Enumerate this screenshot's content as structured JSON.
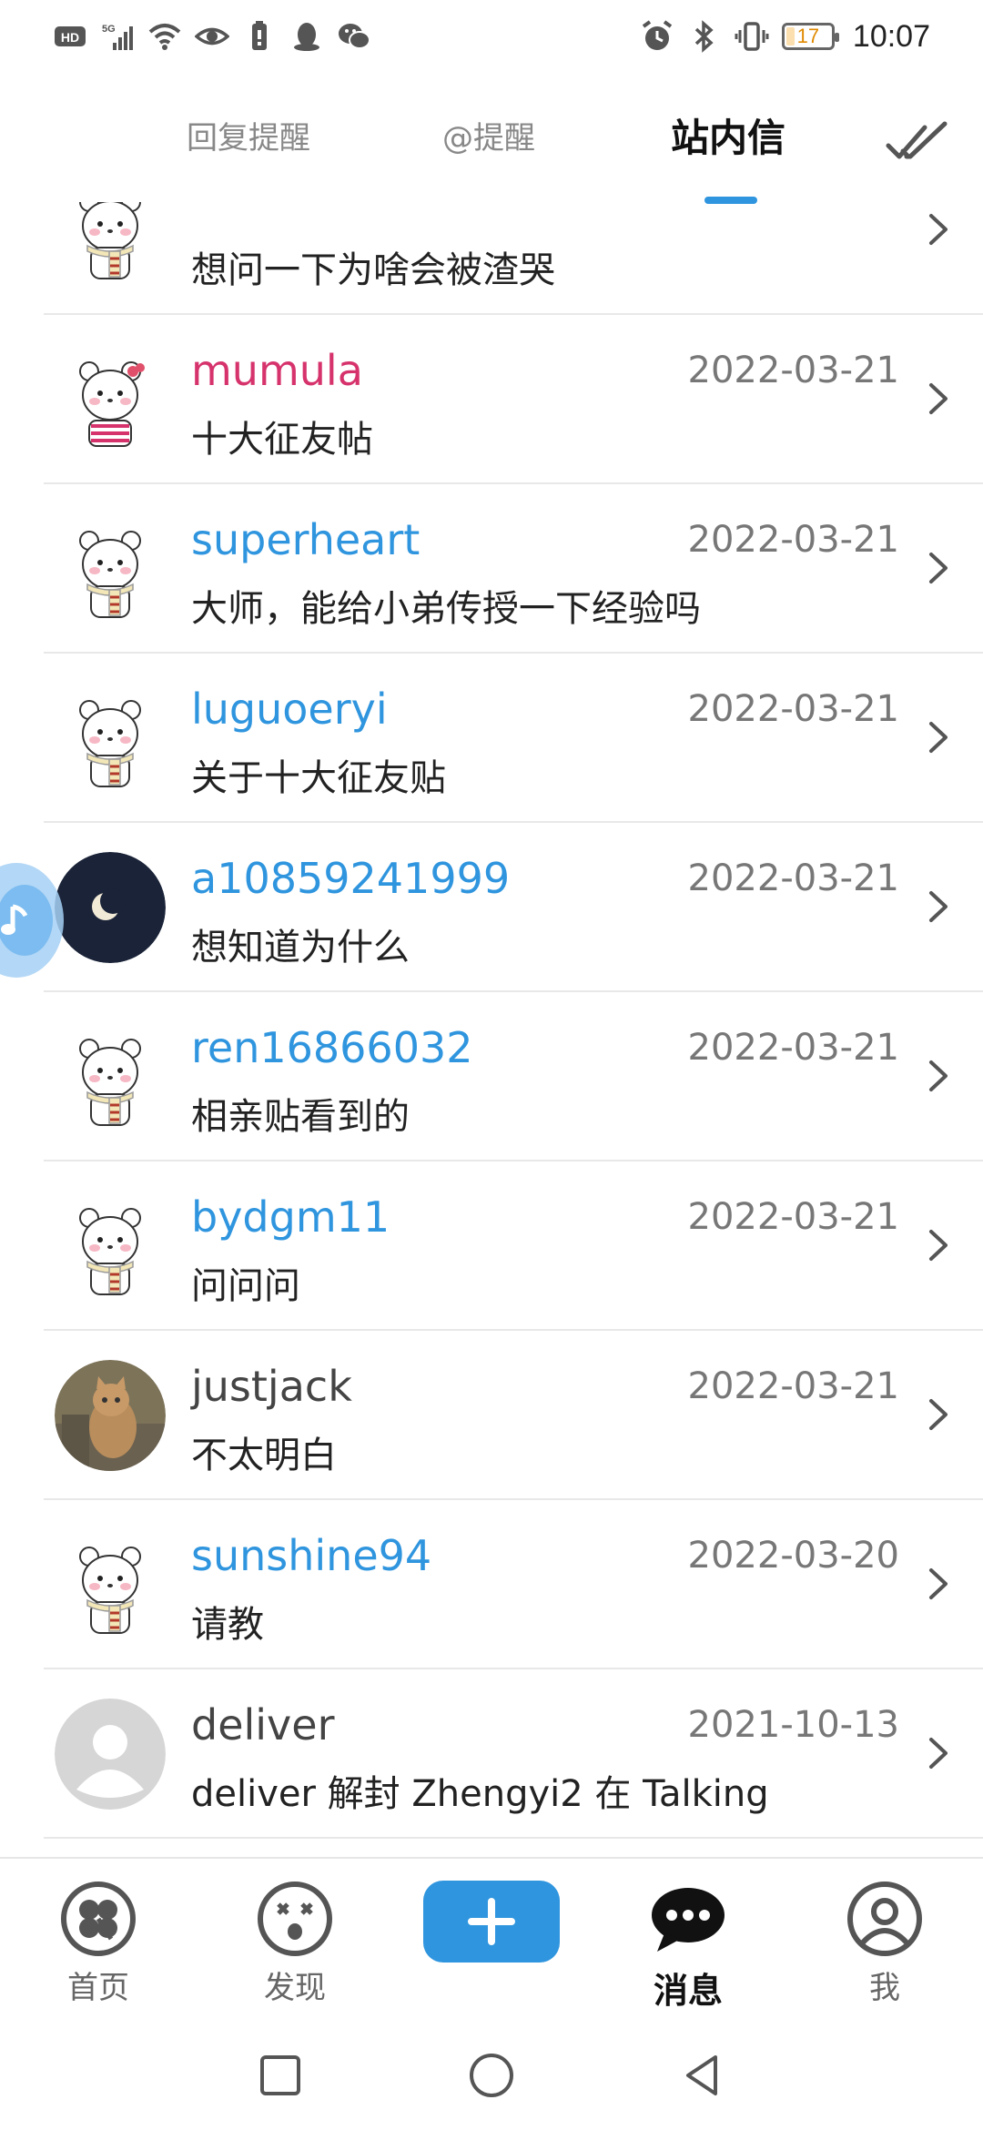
{
  "status_bar": {
    "time": "10:07",
    "battery": "17",
    "left_icons": [
      "hd-icon",
      "signal-5g-icon",
      "wifi-icon",
      "eye-icon",
      "battery-saver-icon",
      "qq-icon",
      "wechat-icon"
    ],
    "right_icons": [
      "alarm-icon",
      "bluetooth-icon",
      "vibrate-icon",
      "battery-icon"
    ]
  },
  "tabs": [
    {
      "label": "回复提醒",
      "active": false
    },
    {
      "label": "@提醒",
      "active": false
    },
    {
      "label": "站内信",
      "active": true
    }
  ],
  "mark_all_read_icon": "double-check-icon",
  "accent_color": "#2f95de",
  "messages": [
    {
      "name": "",
      "name_color": "#2f95de",
      "date": "",
      "text": "想问一下为啥会被渣哭",
      "avatar": "bear-scarf"
    },
    {
      "name": "mumula",
      "name_color": "#d6336c",
      "date": "2022-03-21",
      "text": "十大征友帖",
      "avatar": "bear-girl"
    },
    {
      "name": "superheart",
      "name_color": "#2f95de",
      "date": "2022-03-21",
      "text": "大师，能给小弟传授一下经验吗",
      "avatar": "bear-scarf"
    },
    {
      "name": "luguoeryi",
      "name_color": "#2f95de",
      "date": "2022-03-21",
      "text": "关于十大征友贴",
      "avatar": "bear-scarf"
    },
    {
      "name": "a10859241999",
      "name_color": "#2f95de",
      "date": "2022-03-21",
      "text": "想知道为什么",
      "avatar": "moon"
    },
    {
      "name": "ren16866032",
      "name_color": "#2f95de",
      "date": "2022-03-21",
      "text": "相亲贴看到的",
      "avatar": "bear-scarf"
    },
    {
      "name": "bydgm11",
      "name_color": "#2f95de",
      "date": "2022-03-21",
      "text": "问问问",
      "avatar": "bear-scarf"
    },
    {
      "name": "justjack",
      "name_color": "#444444",
      "date": "2022-03-21",
      "text": "不太明白",
      "avatar": "cat-photo"
    },
    {
      "name": "sunshine94",
      "name_color": "#2f95de",
      "date": "2022-03-20",
      "text": "请教",
      "avatar": "bear-scarf"
    },
    {
      "name": "deliver",
      "name_color": "#444444",
      "date": "2021-10-13",
      "text": "deliver 解封 Zhengyi2 在 Talking",
      "avatar": "default-user"
    }
  ],
  "bottom_nav": [
    {
      "label": "首页",
      "icon": "clover-icon",
      "active": false
    },
    {
      "label": "发现",
      "icon": "dizzy-face-icon",
      "active": false
    },
    {
      "label": "消息",
      "icon": "chat-bubble-icon",
      "active": true
    },
    {
      "label": "我",
      "icon": "user-circle-icon",
      "active": false
    }
  ],
  "compose_icon": "plus-icon",
  "system_nav": [
    "recent-apps-icon",
    "home-icon",
    "back-icon"
  ]
}
